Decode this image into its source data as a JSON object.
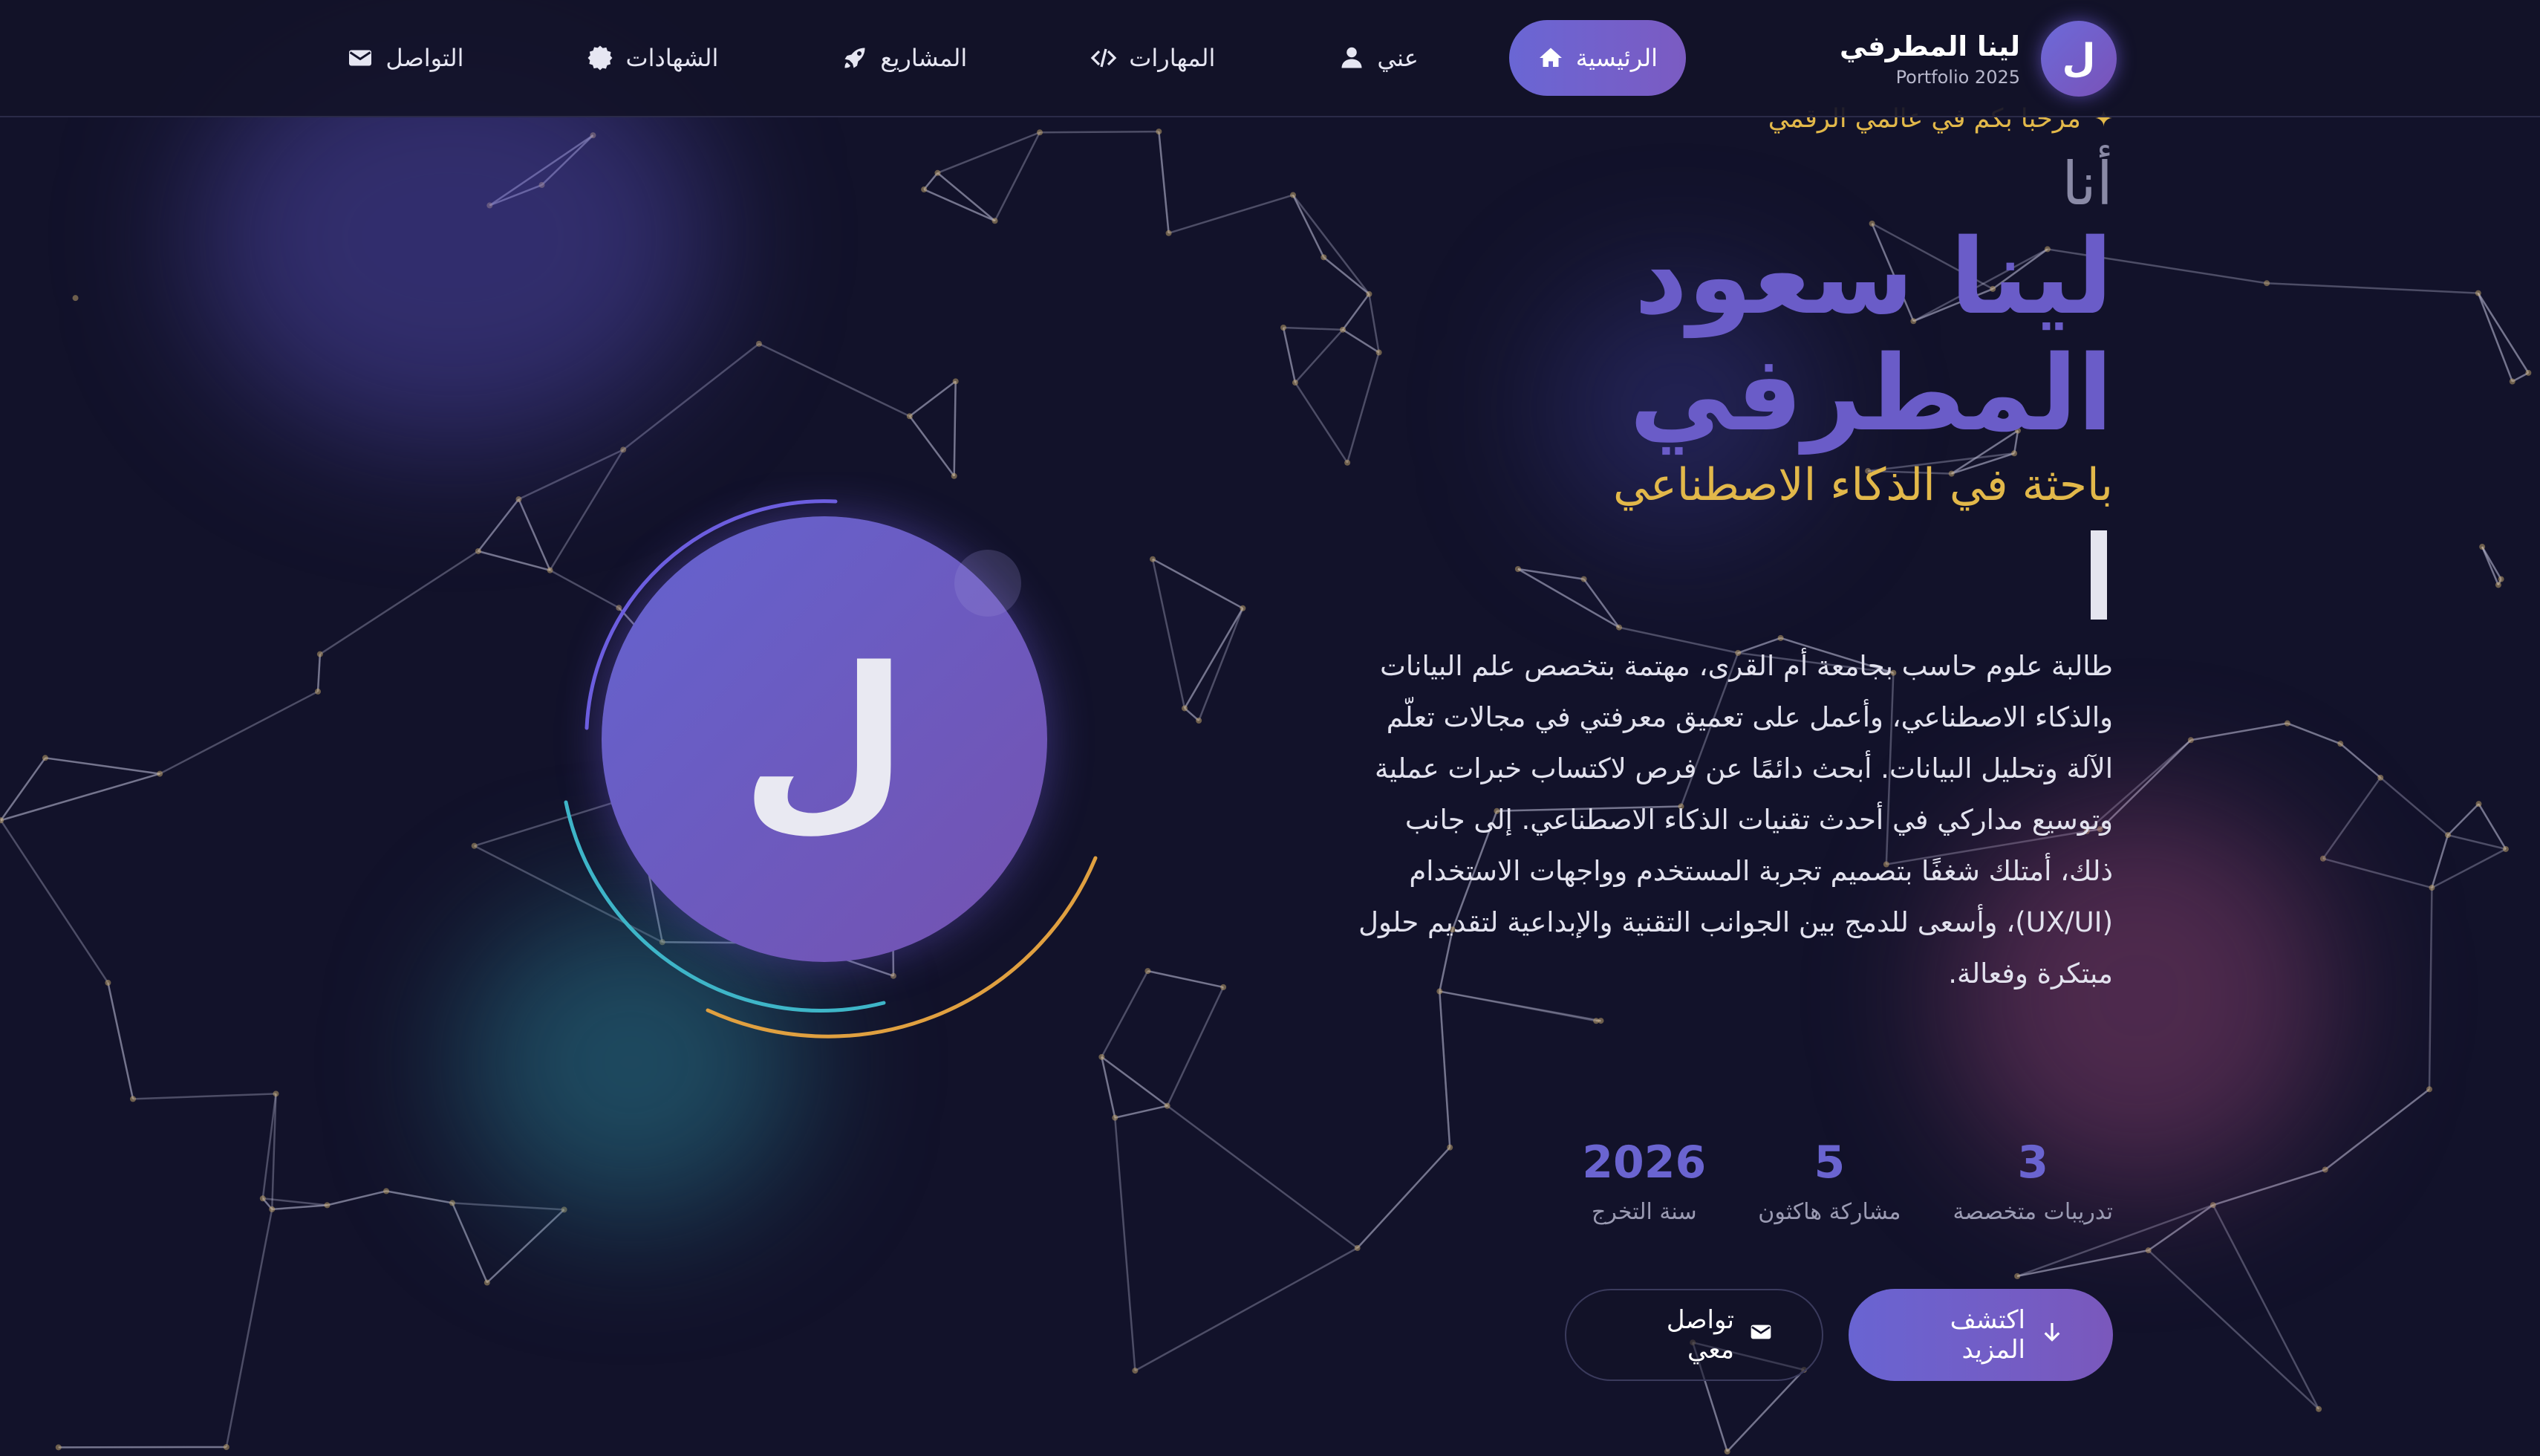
{
  "brand": {
    "avatar_letter": "ل",
    "name": "لينا المطرفي",
    "subtitle": "Portfolio 2025"
  },
  "nav": {
    "items": [
      {
        "label": "الرئيسية",
        "icon": "home-icon",
        "active": true
      },
      {
        "label": "عني",
        "icon": "user-icon",
        "active": false
      },
      {
        "label": "المهارات",
        "icon": "code-icon",
        "active": false
      },
      {
        "label": "المشاريع",
        "icon": "rocket-icon",
        "active": false
      },
      {
        "label": "الشهادات",
        "icon": "certificate-icon",
        "active": false
      },
      {
        "label": "التواصل",
        "icon": "envelope-icon",
        "active": false
      }
    ]
  },
  "hero": {
    "welcome": "مرحبا بكم في عالمي الرقمي",
    "welcome_icon": "sparkle-icon",
    "intro": "أنا",
    "name_line1": "لينا سعود",
    "name_line2": "المطرفي",
    "role": "باحثة في الذكاء الاصطناعي",
    "bio": "طالبة علوم حاسب بجامعة أم القرى، مهتمة بتخصص علم البيانات والذكاء الاصطناعي، وأعمل على تعميق معرفتي في مجالات تعلّم الآلة وتحليل البيانات. أبحث دائمًا عن فرص لاكتساب خبرات عملية وتوسيع مداركي في أحدث تقنيات الذكاء الاصطناعي. إلى جانب ذلك، أمتلك شغفًا بتصميم تجربة المستخدم وواجهات الاستخدام (UX/UI)، وأسعى للدمج بين الجوانب التقنية والإبداعية لتقديم حلول مبتكرة وفعالة."
  },
  "stats": [
    {
      "value": "2026",
      "label": "سنة التخرج"
    },
    {
      "value": "5",
      "label": "مشاركة هاكثون"
    },
    {
      "value": "3",
      "label": "تدريبات متخصصة"
    }
  ],
  "buttons": {
    "primary_label": "اكتشف المزيد",
    "primary_icon": "arrow-down-icon",
    "secondary_label": "تواصل معي",
    "secondary_icon": "envelope-icon"
  },
  "avatar": {
    "letter": "ل"
  },
  "colors": {
    "background": "#12122a",
    "accent_purple": "#6a5cc8",
    "accent_gold": "#e2b84a",
    "ring_teal": "#3fb6c8",
    "ring_gold": "#e0a040"
  }
}
